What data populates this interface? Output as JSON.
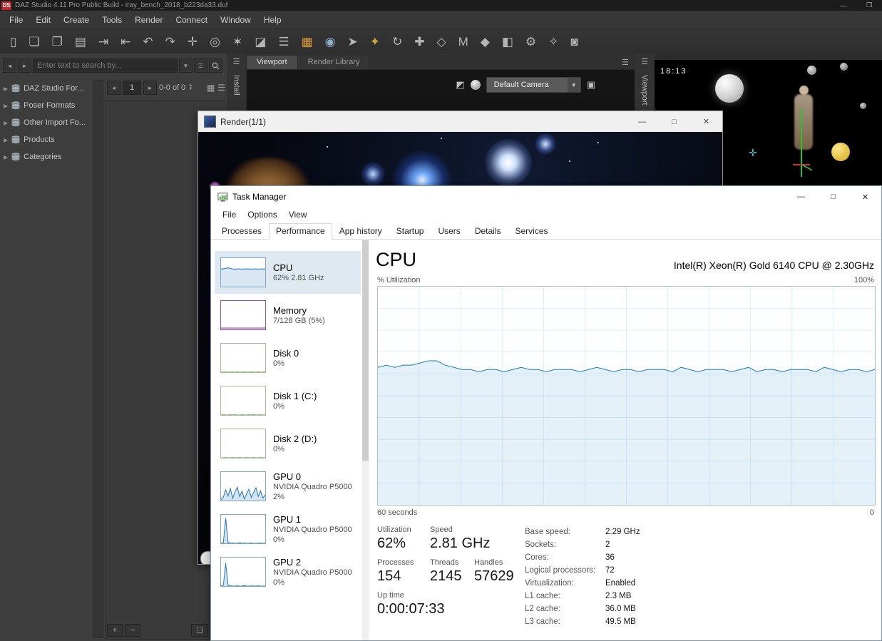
{
  "daz": {
    "window_title": "DAZ Studio 4.11 Pro Public Build - iray_bench_2018_b223da33.duf",
    "logo_text": "DS",
    "window_controls": {
      "minimize": "—",
      "restore": "❐"
    },
    "menu": [
      "File",
      "Edit",
      "Create",
      "Tools",
      "Render",
      "Connect",
      "Window",
      "Help"
    ],
    "toolbar": [
      {
        "name": "new-file-icon",
        "glyph": "▯"
      },
      {
        "name": "open-file-icon",
        "glyph": "❏"
      },
      {
        "name": "open-recent-icon",
        "glyph": "❐"
      },
      {
        "name": "save-icon",
        "glyph": "▤"
      },
      {
        "name": "import-icon",
        "glyph": "⇥"
      },
      {
        "name": "export-icon",
        "glyph": "⇤"
      },
      {
        "name": "undo-icon",
        "glyph": "↶"
      },
      {
        "name": "redo-icon",
        "glyph": "↷"
      },
      {
        "name": "create-null-icon",
        "glyph": "✛"
      },
      {
        "name": "create-camera-icon",
        "glyph": "◎"
      },
      {
        "name": "create-light-icon",
        "glyph": "✶"
      },
      {
        "name": "create-primitive-icon",
        "glyph": "◪"
      },
      {
        "name": "align-icon",
        "glyph": "☰"
      },
      {
        "name": "render-icon",
        "glyph": "▦",
        "color": "#d79b2f"
      },
      {
        "name": "spot-render-icon",
        "glyph": "◉",
        "color": "#8fb0c9"
      },
      {
        "name": "node-selection-tool-icon",
        "glyph": "➤"
      },
      {
        "name": "scene-key-icon",
        "glyph": "✦",
        "color": "#cfa93c"
      },
      {
        "name": "rotate-tool-icon",
        "glyph": "↻"
      },
      {
        "name": "translate-tool-icon",
        "glyph": "✚"
      },
      {
        "name": "scale-tool-icon",
        "glyph": "◇"
      },
      {
        "name": "memorize-pose-icon",
        "glyph": "M"
      },
      {
        "name": "restore-pose-icon",
        "glyph": "◆"
      },
      {
        "name": "surface-selection-icon",
        "glyph": "◧"
      },
      {
        "name": "powerpose-icon",
        "glyph": "⚙"
      },
      {
        "name": "joint-editor-icon",
        "glyph": "✧"
      },
      {
        "name": "camera-capture-icon",
        "glyph": "◙"
      }
    ],
    "content_pane": {
      "search_placeholder": "Enter text to search by...",
      "page_value": "1",
      "range_label": "0-0 of 0",
      "tree_items": [
        {
          "label": "DAZ Studio For..."
        },
        {
          "label": "Poser Formats"
        },
        {
          "label": "Other Import Fo..."
        },
        {
          "label": "Products"
        },
        {
          "label": "Categories"
        }
      ]
    },
    "glyphs": {
      "expander": "▶",
      "prev": "◄",
      "next": "►",
      "spin_up": "▲",
      "spin_down": "▼",
      "grid_view": "▦",
      "list_view": "☰",
      "dropdown": "▼",
      "pane_menu": "☰",
      "plus": "+",
      "minus": "−",
      "corner": "❏",
      "aux_view": "◩",
      "cube": "▣"
    },
    "left_vertical_tab": "Install",
    "right_vertical_tab": "Viewport",
    "viewport_tabs": [
      "Viewport",
      "Render Library"
    ],
    "camera_selector": "Default Camera",
    "scene_timer": "18:13"
  },
  "render_window": {
    "title": "Render(1/1)",
    "controls": {
      "minimize": "—",
      "maximize": "□",
      "close": "✕"
    }
  },
  "task_manager": {
    "title": "Task Manager",
    "controls": {
      "minimize": "—",
      "maximize": "□",
      "close": "✕"
    },
    "menu": [
      "File",
      "Options",
      "View"
    ],
    "tabs": [
      "Processes",
      "Performance",
      "App history",
      "Startup",
      "Users",
      "Details",
      "Services"
    ],
    "active_tab": "Performance",
    "sidebar": [
      {
        "name": "CPU",
        "line1": "62% 2.81 GHz",
        "series": [
          62,
          63,
          64,
          66,
          64,
          62,
          61,
          62,
          62,
          61,
          62,
          62,
          62,
          61,
          62,
          62,
          61,
          62,
          62,
          62
        ]
      },
      {
        "name": "Memory",
        "line1": "7/128 GB (5%)",
        "series": [
          5,
          5,
          5,
          5,
          5,
          5,
          5,
          5,
          5,
          5,
          5,
          5,
          5,
          5,
          5,
          5,
          5,
          5,
          5,
          5
        ]
      },
      {
        "name": "Disk 0",
        "line1": "0%",
        "series": [
          1,
          0,
          1,
          0,
          0,
          1,
          0,
          1,
          0,
          0,
          1,
          0,
          0,
          1,
          0,
          0,
          1,
          0,
          0,
          1
        ]
      },
      {
        "name": "Disk 1 (C:)",
        "line1": "0%",
        "series": [
          0,
          1,
          0,
          0,
          1,
          0,
          1,
          0,
          0,
          1,
          0,
          0,
          1,
          0,
          1,
          0,
          0,
          1,
          0,
          0
        ]
      },
      {
        "name": "Disk 2 (D:)",
        "line1": "0%",
        "series": [
          0,
          0,
          1,
          0,
          0,
          1,
          0,
          0,
          1,
          0,
          0,
          1,
          0,
          0,
          1,
          0,
          0,
          1,
          0,
          0
        ]
      },
      {
        "name": "GPU 0",
        "line1": "NVIDIA Quadro P5000",
        "line2": "2%",
        "series": [
          3,
          12,
          38,
          16,
          42,
          8,
          30,
          47,
          14,
          33,
          6,
          24,
          40,
          11,
          28,
          45,
          15,
          34,
          9,
          20
        ]
      },
      {
        "name": "GPU 1",
        "line1": "NVIDIA Quadro P5000",
        "line2": "0%",
        "series": [
          0,
          2,
          88,
          4,
          0,
          1,
          0,
          0,
          2,
          0,
          1,
          0,
          0,
          1,
          0,
          0,
          0,
          1,
          0,
          0
        ]
      },
      {
        "name": "GPU 2",
        "line1": "NVIDIA Quadro P5000",
        "line2": "0%",
        "series": [
          0,
          3,
          80,
          3,
          1,
          0,
          0,
          1,
          0,
          0,
          2,
          0,
          0,
          1,
          0,
          0,
          1,
          0,
          0,
          0
        ]
      }
    ],
    "performance": {
      "heading": "CPU",
      "subtitle": "Intel(R) Xeon(R) Gold 6140 CPU @ 2.30GHz",
      "axis_top_left": "% Utilization",
      "axis_top_right": "100%",
      "axis_bottom_left": "60 seconds",
      "axis_bottom_right": "0",
      "utilization_series": [
        63,
        64,
        63,
        64,
        64,
        65,
        66,
        66,
        64,
        63,
        62,
        62,
        61,
        62,
        62,
        61,
        62,
        63,
        62,
        62,
        61,
        62,
        62,
        62,
        61,
        62,
        63,
        62,
        61,
        62,
        62,
        61,
        62,
        62,
        62,
        61,
        63,
        62,
        61,
        62,
        62,
        62,
        61,
        62,
        63,
        61,
        62,
        62,
        61,
        62,
        62,
        62,
        61,
        63,
        62,
        61,
        62,
        62,
        61,
        62
      ],
      "stats": [
        {
          "label": "Utilization",
          "value": "62%"
        },
        {
          "label": "Speed",
          "value": "2.81 GHz"
        },
        {
          "label": "Processes",
          "value": "154"
        },
        {
          "label": "Threads",
          "value": "2145"
        },
        {
          "label": "Handles",
          "value": "57629"
        },
        {
          "label": "Up time",
          "value": "0:00:07:33"
        }
      ],
      "details": [
        {
          "label": "Base speed:",
          "value": "2.29 GHz"
        },
        {
          "label": "Sockets:",
          "value": "2"
        },
        {
          "label": "Cores:",
          "value": "36"
        },
        {
          "label": "Logical processors:",
          "value": "72"
        },
        {
          "label": "Virtualization:",
          "value": "Enabled"
        },
        {
          "label": "L1 cache:",
          "value": "2.3 MB"
        },
        {
          "label": "L2 cache:",
          "value": "36.0 MB"
        },
        {
          "label": "L3 cache:",
          "value": "49.5 MB"
        }
      ]
    },
    "colors": {
      "cpu_line": "#1c7dbd",
      "cpu_fill": "rgba(17,125,187,0.10)",
      "memory_line": "#9a4fae",
      "disk_line": "#69a74f",
      "grid": "#e3edf6"
    }
  }
}
